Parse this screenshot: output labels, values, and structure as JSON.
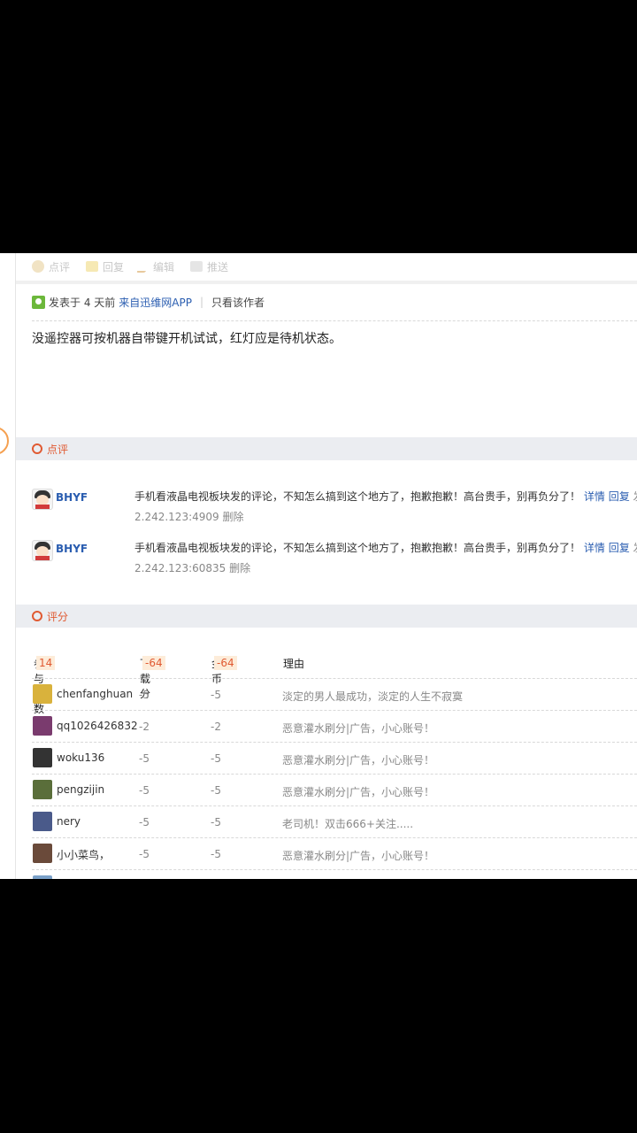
{
  "toolbar": {
    "items": [
      {
        "label": "点评",
        "icon": "comment-icon"
      },
      {
        "label": "回复",
        "icon": "reply-icon"
      },
      {
        "label": "编辑",
        "icon": "edit-icon"
      },
      {
        "label": "推送",
        "icon": "push-icon"
      }
    ]
  },
  "post": {
    "posted": "发表于 4 天前",
    "source": "来自迅维网APP",
    "author_only": "只看该作者",
    "body": "没遥控器可按机器自带键开机试试，红灯应是待机状态。"
  },
  "review_section": {
    "title": "点评",
    "items": [
      {
        "user": "BHYF",
        "text": "手机看液晶电视板块发的评论，不知怎么搞到这个地方了，抱歉抱歉！高台贵手，别再负分了！",
        "detail": "详情",
        "reply": "回复",
        "tail": "发表",
        "ip": "2.242.123:4909",
        "delete": "删除"
      },
      {
        "user": "BHYF",
        "text": "手机看液晶电视板块发的评论，不知怎么搞到这个地方了，抱歉抱歉！高台贵手，别再负分了！",
        "detail": "详情",
        "reply": "回复",
        "tail": "发表",
        "ip": "2.242.123:60835",
        "delete": "删除"
      }
    ]
  },
  "rating_section": {
    "title": "评分",
    "columns": {
      "participants_label": "参与人数",
      "participants": "14",
      "download_label": "下载分",
      "download_total": "-64",
      "gold_label": "金币",
      "gold_total": "-64",
      "reason_label": "理由"
    },
    "rows": [
      {
        "user": "chenfanghuan",
        "download": "-5",
        "gold": "-5",
        "reason": "淡定的男人最成功，淡定的人生不寂寞",
        "avatar_color": "#d9b23c"
      },
      {
        "user": "qq1026426832",
        "download": "-2",
        "gold": "-2",
        "reason": "恶意灌水刷分|广告，小心账号！",
        "avatar_color": "#7a3b6e"
      },
      {
        "user": "woku136",
        "download": "-5",
        "gold": "-5",
        "reason": "恶意灌水刷分|广告，小心账号！",
        "avatar_color": "#333333"
      },
      {
        "user": "pengzijin",
        "download": "-5",
        "gold": "-5",
        "reason": "恶意灌水刷分|广告，小心账号！",
        "avatar_color": "#5a6e3a"
      },
      {
        "user": "nery",
        "download": "-5",
        "gold": "-5",
        "reason": "老司机！双击666+关注.....",
        "avatar_color": "#4a5a8a"
      },
      {
        "user": "小小菜鸟，",
        "download": "-5",
        "gold": "-5",
        "reason": "恶意灌水刷分|广告，小心账号！",
        "avatar_color": "#6a4a3a"
      }
    ]
  }
}
